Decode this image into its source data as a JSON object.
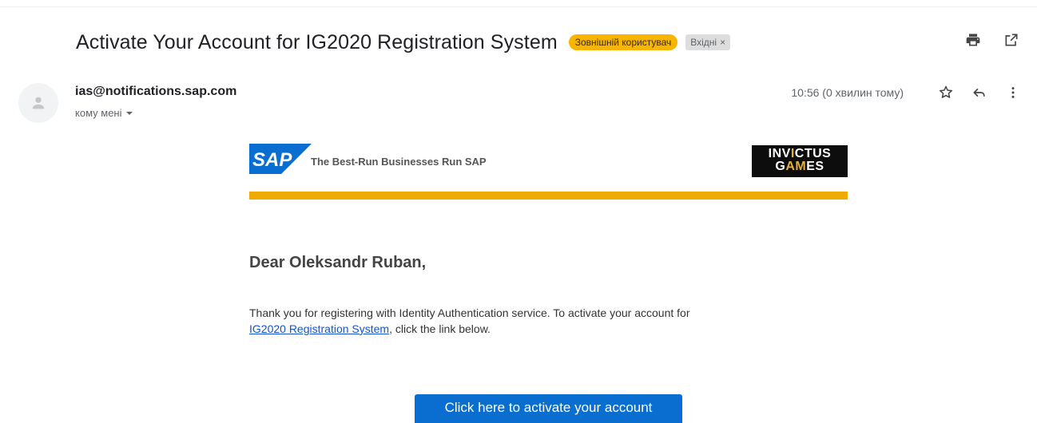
{
  "email": {
    "subject": "Activate Your Account for IG2020 Registration System",
    "labels": {
      "external": "Зовнішній користувач",
      "inbox": "Вхідні",
      "inbox_remove": "×"
    },
    "sender": {
      "address": "ias@notifications.sap.com",
      "recipient": "кому мені",
      "timestamp": "10:56 (0 хвилин тому)"
    },
    "icons": {
      "print": "print-icon",
      "open_new_window": "open-in-new-window-icon",
      "star": "star-icon",
      "reply": "reply-icon",
      "more": "more-vert-icon",
      "avatar": "person-icon",
      "dropdown": "caret-down-icon"
    }
  },
  "body": {
    "brand_logo": "SAP",
    "tagline": "The Best-Run Businesses Run SAP",
    "partner_logo": {
      "line1_a": "INV",
      "line1_b": "I",
      "line1_c": "CTUS",
      "line2_a": "G",
      "line2_b": "AM",
      "line2_c": "ES"
    },
    "greeting": "Dear Oleksandr Ruban,",
    "message_part1": "Thank you for registering with Identity Authentication service. To activate your account for",
    "message_link": "IG2020 Registration System",
    "message_part2": ", click the link below.",
    "activate_button": "Click here to activate your account",
    "colors": {
      "accent_gold": "#f0ab00",
      "button_blue": "#0a6ed1",
      "label_yellow": "#f8b500",
      "link_blue": "#1155cc"
    }
  }
}
